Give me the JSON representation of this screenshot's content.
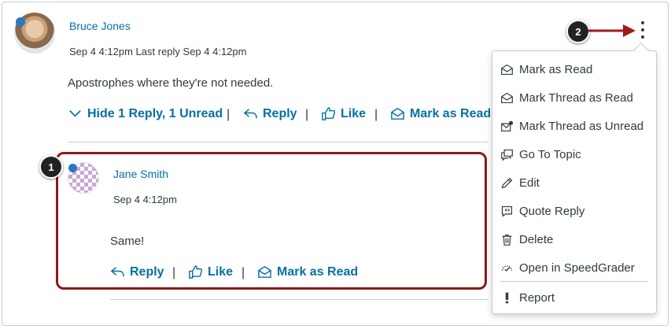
{
  "post": {
    "author": "Bruce Jones",
    "meta": "Sep 4 4:12pm  Last reply Sep 4 4:12pm",
    "message": "Apostrophes where they're not needed.",
    "actions": {
      "hide_replies": "Hide 1 Reply, 1 Unread",
      "reply": "Reply",
      "like": "Like",
      "mark_read": "Mark as Read"
    },
    "separator": "|"
  },
  "reply": {
    "author": "Jane Smith",
    "meta": "Sep 4 4:12pm",
    "message": "Same!",
    "actions": {
      "reply": "Reply",
      "like": "Like",
      "mark_read": "Mark as Read"
    }
  },
  "callouts": {
    "one": "1",
    "two": "2"
  },
  "menu": {
    "items": [
      {
        "label": "Mark as Read",
        "icon": "envelope-open-icon"
      },
      {
        "label": "Mark Thread as Read",
        "icon": "envelope-open-icon"
      },
      {
        "label": "Mark Thread as Unread",
        "icon": "envelope-unread-icon"
      },
      {
        "label": "Go To Topic",
        "icon": "discussion-icon"
      },
      {
        "label": "Edit",
        "icon": "pencil-icon"
      },
      {
        "label": "Quote Reply",
        "icon": "quote-icon"
      },
      {
        "label": "Delete",
        "icon": "trash-icon"
      },
      {
        "label": "Open in SpeedGrader",
        "icon": "speedgrader-icon"
      },
      {
        "label": "Report",
        "icon": "exclamation-icon"
      }
    ]
  },
  "colors": {
    "link": "#0770a3",
    "unread_dot": "#2b7abc",
    "highlight_border": "#8b1a1a",
    "arrow": "#a01c1c",
    "text": "#2d3b45"
  }
}
